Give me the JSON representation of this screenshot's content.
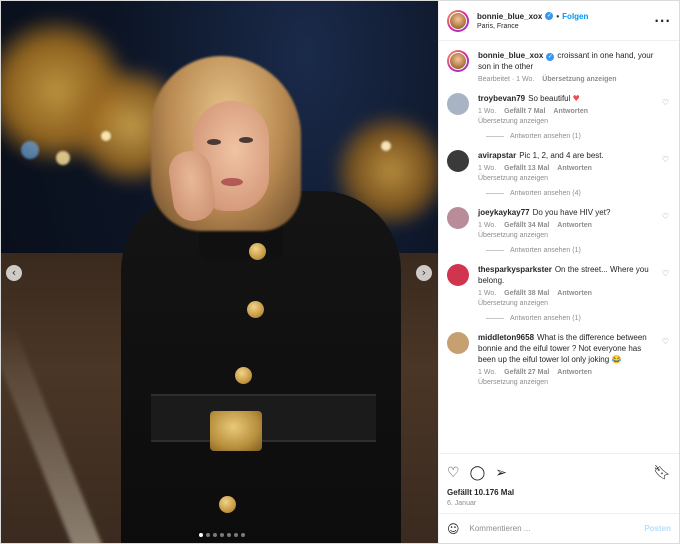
{
  "header": {
    "username": "bonnie_blue_xox",
    "separator": "•",
    "follow_label": "Folgen",
    "location": "Paris, France",
    "more_icon": "more-options-icon"
  },
  "caption": {
    "username": "bonnie_blue_xox",
    "text": "croissant in one hand, your son in the other",
    "edited": "Bearbeitet · 1 Wo.",
    "translate": "Übersetzung anzeigen"
  },
  "comments": [
    {
      "username": "troybevan79",
      "text": "So beautiful",
      "emoji": "♥",
      "time": "1 Wo.",
      "likes": "Gefällt 7 Mal",
      "reply": "Antworten",
      "translate": "Übersetzung anzeigen",
      "replies": "Antworten ansehen (1)",
      "avatar_color": "#a8b4c4"
    },
    {
      "username": "avirapstar",
      "text": "Pic 1, 2, and 4 are best.",
      "time": "1 Wo.",
      "likes": "Gefällt 13 Mal",
      "reply": "Antworten",
      "translate": "Übersetzung anzeigen",
      "replies": "Antworten ansehen (4)",
      "avatar_color": "#3a3a3a"
    },
    {
      "username": "joeykaykay77",
      "text": "Do you have HIV yet?",
      "time": "1 Wo.",
      "likes": "Gefällt 34 Mal",
      "reply": "Antworten",
      "translate": "Übersetzung anzeigen",
      "replies": "Antworten ansehen (1)",
      "avatar_color": "#b98c9a"
    },
    {
      "username": "thesparkysparkster",
      "text": "On the street... Where you belong.",
      "time": "1 Wo.",
      "likes": "Gefällt 38 Mal",
      "reply": "Antworten",
      "translate": "Übersetzung anzeigen",
      "replies": "Antworten ansehen (1)",
      "avatar_color": "#d0344e"
    },
    {
      "username": "middleton9658",
      "text": "What is the difference between bonnie and the eiful tower ? Not everyone has been up the eiful tower lol only joking",
      "emoji": "😂",
      "time": "1 Wo.",
      "likes": "Gefällt 27 Mal",
      "reply": "Antworten",
      "translate": "Übersetzung anzeigen",
      "avatar_color": "#c6a070"
    }
  ],
  "actions": {
    "likes": "Gefällt 10.176 Mal",
    "date": "6. Januar"
  },
  "comment_box": {
    "placeholder": "Kommentieren ...",
    "post_label": "Posten"
  },
  "carousel": {
    "prev": "‹",
    "next": "›",
    "slide_count": 7,
    "active_index": 0
  },
  "colors": {
    "accent_blue": "#0095f6",
    "heart_red": "#ed4956",
    "muted_gray": "#8e8e8e"
  }
}
